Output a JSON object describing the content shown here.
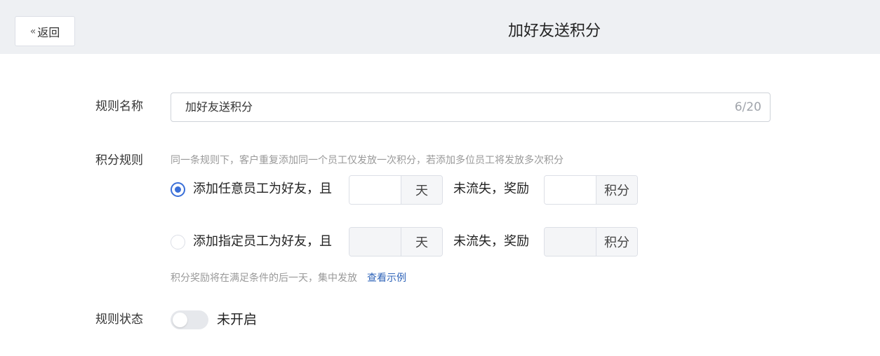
{
  "header": {
    "back_label": "返回",
    "back_icon": "double-chevron-left-icon",
    "title": "加好友送积分"
  },
  "form": {
    "rule_name": {
      "label": "规则名称",
      "value": "加好友送积分",
      "counter": "6/20"
    },
    "points_rule": {
      "label": "积分规则",
      "hint": "同一条规则下，客户重复添加同一个员工仅发放一次积分，若添加多位员工将发放多次积分",
      "options": [
        {
          "selected": true,
          "text": "添加任意员工为好友，且",
          "days_unit": "天",
          "middle_text": "未流失，奖励",
          "points_unit": "积分"
        },
        {
          "selected": false,
          "text": "添加指定员工为好友，且",
          "days_unit": "天",
          "middle_text": "未流失，奖励",
          "points_unit": "积分"
        }
      ],
      "footer_hint": "积分奖励将在满足条件的后一天，集中发放",
      "example_link": "查看示例"
    },
    "rule_status": {
      "label": "规则状态",
      "enabled": false,
      "status_text": "未开启"
    }
  },
  "colors": {
    "accent": "#3a6fd8",
    "link": "#2e63b8",
    "header_bg": "#eef0f3"
  }
}
